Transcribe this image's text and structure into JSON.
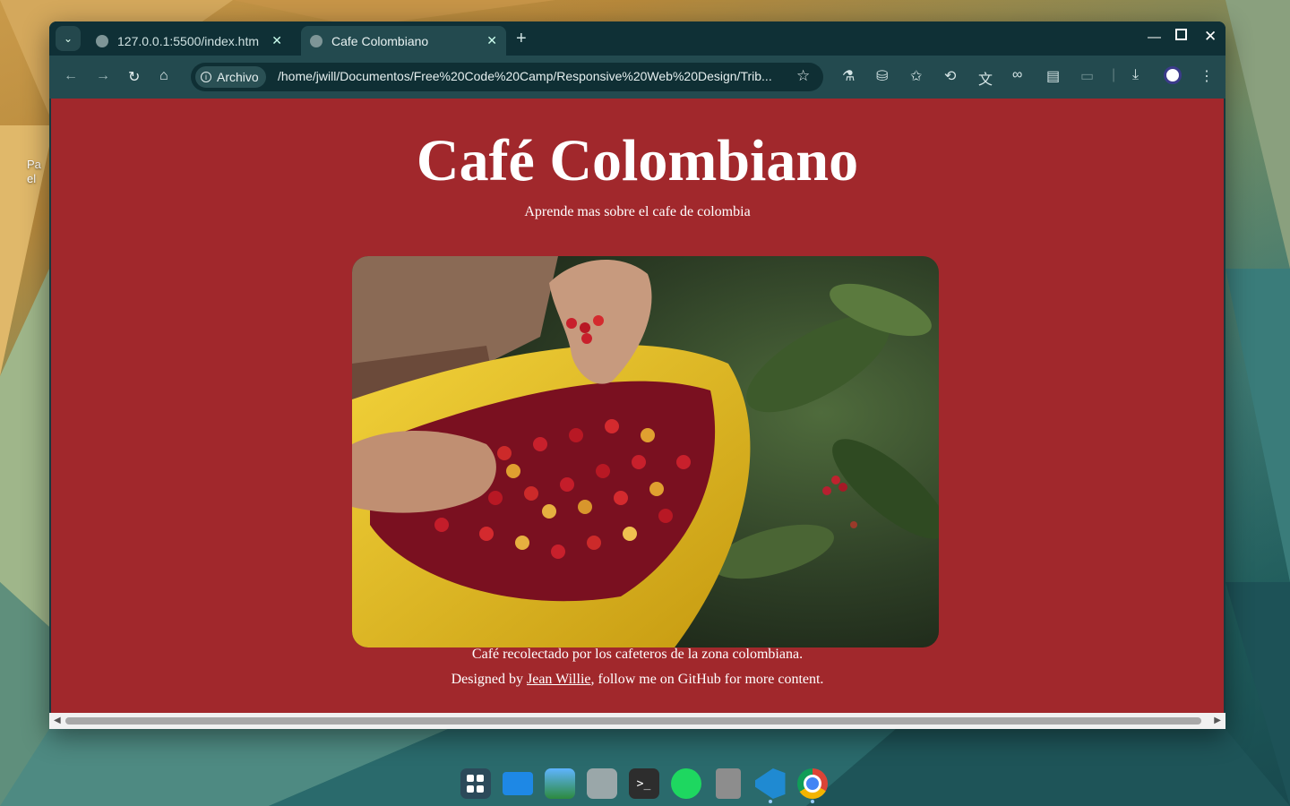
{
  "desktop": {
    "label_line1": "Pa",
    "label_line2": "el"
  },
  "browser": {
    "tabs": [
      {
        "title": "127.0.0.1:5500/index.htm",
        "active": false
      },
      {
        "title": "Cafe Colombiano",
        "active": true
      }
    ],
    "omnibox": {
      "chip_label": "Archivo",
      "url": "/home/jwill/Documentos/Free%20Code%20Camp/Responsive%20Web%20Design/Trib..."
    }
  },
  "page": {
    "title": "Café Colombiano",
    "subtitle": "Aprende mas sobre el cafe de colombia",
    "caption": "Café recolectado por los cafeteros de la zona colombiana.",
    "footer": {
      "prefix": "Designed by ",
      "link": "Jean Willie",
      "suffix": ", follow me on GitHub for more content."
    }
  },
  "dock": {
    "apps": [
      "apps-grid-icon",
      "desktop-icon",
      "photos-icon",
      "files-icon",
      "terminal-icon",
      "spotify-icon",
      "trash-icon",
      "vscode-icon",
      "chrome-icon"
    ]
  },
  "colors": {
    "page_background": "#a1282c",
    "browser_frame": "#234a4f"
  }
}
